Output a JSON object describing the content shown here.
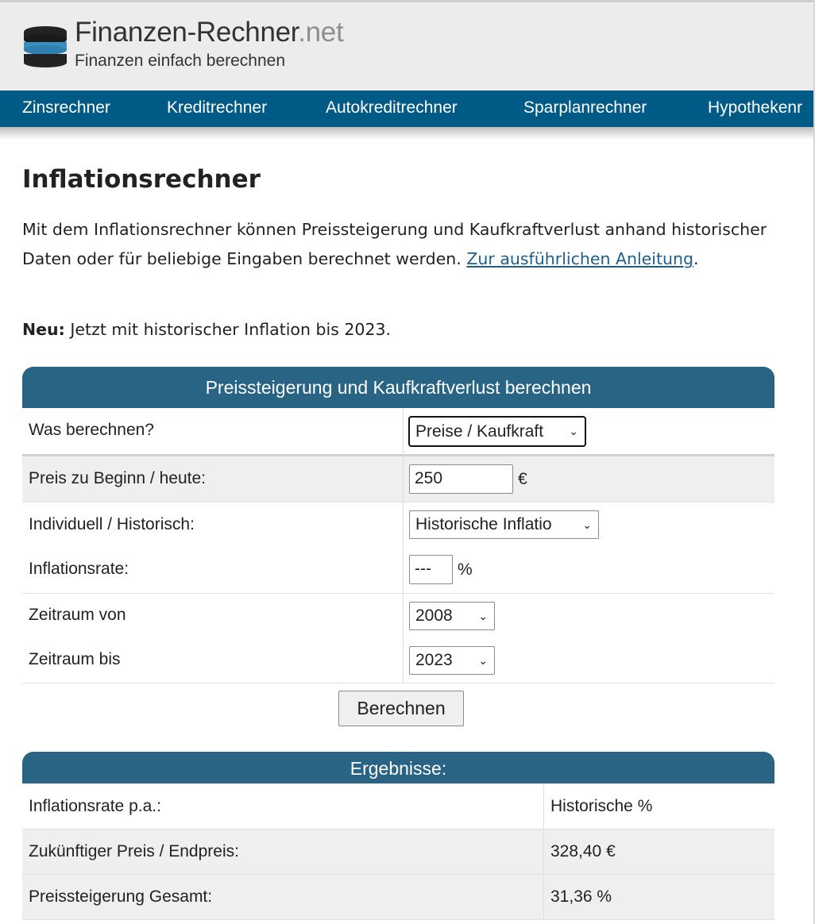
{
  "site": {
    "name": "Finanzen-Rechner",
    "tld": ".net",
    "tagline": "Finanzen einfach berechnen",
    "accent_color": "#005a86",
    "box_color": "#296485"
  },
  "nav": {
    "items": [
      "Zinsrechner",
      "Kreditrechner",
      "Autokreditrechner",
      "Sparplanrechner",
      "Hypothekenr"
    ]
  },
  "page": {
    "title": "Inflationsrechner",
    "intro_text": "Mit dem Inflationsrechner können Preissteigerung und Kaufkraftverlust anhand historischer Daten oder für beliebige Eingaben berechnet werden. ",
    "intro_link": "Zur ausführlichen Anleitung",
    "intro_end": ".",
    "new_label": "Neu:",
    "new_text": " Jetzt mit historischer Inflation bis 2023."
  },
  "form": {
    "header": "Preissteigerung und Kaufkraftverlust berechnen",
    "was_label": "Was berechnen?",
    "was_value": "Preise / Kaufkraft",
    "preis_label": "Preis zu Beginn / heute:",
    "preis_value": "250",
    "preis_unit": "€",
    "mode_label": "Individuell / Historisch:",
    "mode_value": "Historische Inflatio",
    "rate_label": "Inflationsrate:",
    "rate_value": "---",
    "rate_unit": "%",
    "from_label": "Zeitraum von",
    "from_value": "2008",
    "to_label": "Zeitraum bis",
    "to_value": "2023",
    "submit_label": "Berechnen"
  },
  "results": {
    "header": "Ergebnisse:",
    "rows": [
      {
        "label": "Inflationsrate p.a.:",
        "value": "Historische %"
      },
      {
        "label": "Zukünftiger Preis / Endpreis:",
        "value": "328,40 €"
      },
      {
        "label": "Preissteigerung Gesamt:",
        "value": "31,36 %"
      }
    ]
  }
}
